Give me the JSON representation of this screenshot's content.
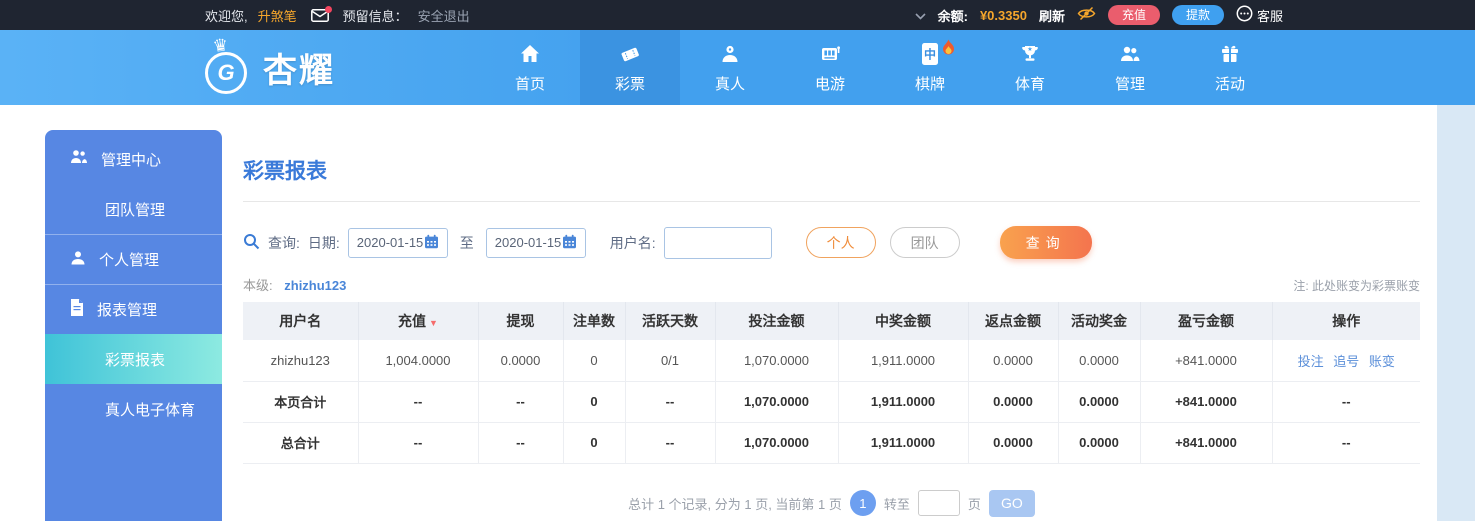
{
  "topbar": {
    "welcome_prefix": "欢迎您,",
    "username": "升煞笔",
    "reserved_label": "预留信息：",
    "logout": "安全退出",
    "balance_label": "余额:",
    "balance_value": "¥0.3350",
    "refresh": "刷新",
    "deposit": "充值",
    "withdraw": "提款",
    "service": "客服"
  },
  "nav": {
    "brand": "杏耀",
    "items": [
      {
        "label": "首页",
        "icon": "home-icon"
      },
      {
        "label": "彩票",
        "icon": "ticket-icon",
        "active": true
      },
      {
        "label": "真人",
        "icon": "live-person-icon"
      },
      {
        "label": "电游",
        "icon": "slot-machine-icon"
      },
      {
        "label": "棋牌",
        "icon": "mahjong-tile-icon",
        "badge": "flame-badge-icon"
      },
      {
        "label": "体育",
        "icon": "trophy-icon"
      },
      {
        "label": "管理",
        "icon": "users-icon"
      },
      {
        "label": "活动",
        "icon": "gift-icon"
      }
    ]
  },
  "sidebar": {
    "items": [
      {
        "label": "管理中心",
        "icon": "group-icon",
        "type": "section"
      },
      {
        "label": "团队管理",
        "type": "sub"
      },
      {
        "label": "个人管理",
        "icon": "user-icon",
        "type": "section"
      },
      {
        "label": "报表管理",
        "icon": "file-icon",
        "type": "section"
      },
      {
        "label": "彩票报表",
        "type": "sub",
        "active": true
      },
      {
        "label": "真人电子体育",
        "type": "sub"
      }
    ]
  },
  "main": {
    "title": "彩票报表",
    "search": {
      "query_label": "查询:",
      "date_label": "日期:",
      "date_from": "2020-01-15",
      "to_label": "至",
      "date_to": "2020-01-15",
      "username_label": "用户名:",
      "personal_btn": "个人",
      "team_btn": "团队",
      "search_btn": "查询"
    },
    "level_label": "本级:",
    "level_user": "zhizhu123",
    "note": "注: 此处账变为彩票账变",
    "table": {
      "headers": [
        "用户名",
        "充值",
        "提现",
        "注单数",
        "活跃天数",
        "投注金额",
        "中奖金额",
        "返点金额",
        "活动奖金",
        "盈亏金额",
        "操作"
      ],
      "sort_indicator": "▼",
      "rows": [
        {
          "cells": [
            "zhizhu123",
            "1,004.0000",
            "0.0000",
            "0",
            "0/1",
            "1,070.0000",
            "1,911.0000",
            "0.0000",
            "0.0000",
            "+841.0000"
          ]
        },
        {
          "cells": [
            "本页合计",
            "--",
            "--",
            "0",
            "--",
            "1,070.0000",
            "1,911.0000",
            "0.0000",
            "0.0000",
            "+841.0000"
          ],
          "ops": "--"
        },
        {
          "cells": [
            "总合计",
            "--",
            "--",
            "0",
            "--",
            "1,070.0000",
            "1,911.0000",
            "0.0000",
            "0.0000",
            "+841.0000"
          ],
          "ops": "--"
        }
      ],
      "actions": [
        "投注",
        "追号",
        "账变"
      ]
    },
    "pagination": {
      "summary": "总计 1 个记录, 分为 1 页, 当前第 1 页",
      "current_page": "1",
      "goto_label": "转至",
      "page_label": "页",
      "go_btn": "GO"
    }
  },
  "colors": {
    "topbar_bg": "#1f2531",
    "nav_blue": "#42a0ee",
    "accent_orange": "#f5a62c",
    "deposit_red": "#ea5d6d",
    "withdraw_blue": "#3fa0f0",
    "sidebar_blue": "#5787e3",
    "active_cyan": "#3fc3d8",
    "title_blue": "#3a7ad9",
    "sort_red": "#f56c6c",
    "profit_green": "#21a13a",
    "link_blue": "#5b8fd9"
  }
}
